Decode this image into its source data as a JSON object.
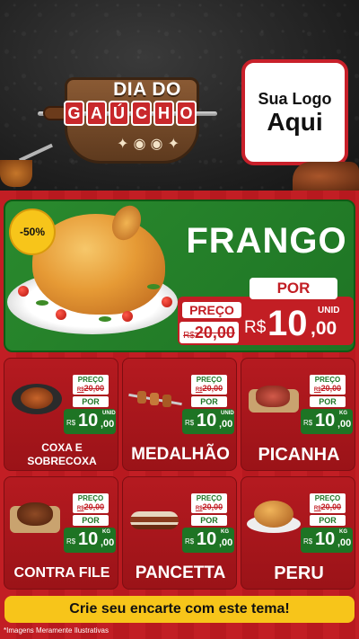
{
  "header": {
    "badge_line1": "DIA DO",
    "badge_letters": [
      "G",
      "A",
      "Ú",
      "C",
      "H",
      "O"
    ],
    "logo_line1": "Sua Logo",
    "logo_line2": "Aqui"
  },
  "hero": {
    "discount": "-50%",
    "title": "FRANGO",
    "por_label": "POR",
    "preco_label": "PREÇO",
    "old_currency": "R$",
    "old_price": "20,00",
    "new_currency": "R$",
    "new_int": "10",
    "new_cents": ",00",
    "unit": "UNID"
  },
  "products": [
    {
      "name": "COXA E SOBRECOXA",
      "preco_label": "PREÇO",
      "old_currency": "R$",
      "old_price": "20,00",
      "por_label": "POR",
      "currency": "R$",
      "int": "10",
      "cents": ",00",
      "unit": "UNID"
    },
    {
      "name": "MEDALHÃO",
      "preco_label": "PREÇO",
      "old_currency": "R$",
      "old_price": "20,00",
      "por_label": "POR",
      "currency": "R$",
      "int": "10",
      "cents": ",00",
      "unit": "UNID"
    },
    {
      "name": "PICANHA",
      "preco_label": "PREÇO",
      "old_currency": "R$",
      "old_price": "20,00",
      "por_label": "POR",
      "currency": "R$",
      "int": "10",
      "cents": ",00",
      "unit": "KG"
    },
    {
      "name": "CONTRA FILE",
      "preco_label": "PREÇO",
      "old_currency": "R$",
      "old_price": "20,00",
      "por_label": "POR",
      "currency": "R$",
      "int": "10",
      "cents": ",00",
      "unit": "KG"
    },
    {
      "name": "PANCETTA",
      "preco_label": "PREÇO",
      "old_currency": "R$",
      "old_price": "20,00",
      "por_label": "POR",
      "currency": "R$",
      "int": "10",
      "cents": ",00",
      "unit": "KG"
    },
    {
      "name": "PERU",
      "preco_label": "PREÇO",
      "old_currency": "R$",
      "old_price": "20,00",
      "por_label": "POR",
      "currency": "R$",
      "int": "10",
      "cents": ",00",
      "unit": "KG"
    }
  ],
  "footer": {
    "cta": "Crie seu encarte com este tema!",
    "disclaimer": "*Imagens Meramente Ilustrativas"
  },
  "colors": {
    "red": "#c21e24",
    "green": "#1e7424",
    "yellow": "#f7c51a"
  }
}
